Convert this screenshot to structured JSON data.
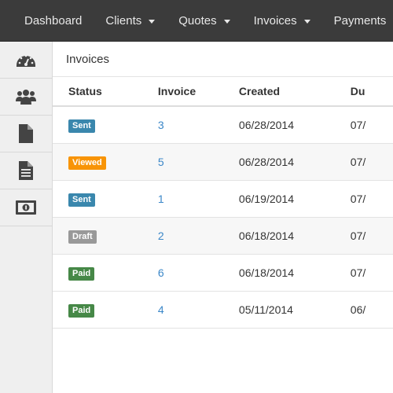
{
  "nav": {
    "items": [
      {
        "label": "Dashboard",
        "dropdown": false
      },
      {
        "label": "Clients",
        "dropdown": true
      },
      {
        "label": "Quotes",
        "dropdown": true
      },
      {
        "label": "Invoices",
        "dropdown": true
      },
      {
        "label": "Payments",
        "dropdown": true
      }
    ]
  },
  "sidebar": {
    "items": [
      "dashboard-gauge-icon",
      "clients-users-icon",
      "quote-file-icon",
      "invoice-document-icon",
      "payment-money-icon"
    ]
  },
  "page": {
    "title": "Invoices"
  },
  "table": {
    "headers": [
      "Status",
      "Invoice",
      "Created",
      "Du"
    ],
    "rows": [
      {
        "status": "Sent",
        "status_color": "#3a87ad",
        "invoice": "3",
        "created": "06/28/2014",
        "due": "07/"
      },
      {
        "status": "Viewed",
        "status_color": "#f89406",
        "invoice": "5",
        "created": "06/28/2014",
        "due": "07/"
      },
      {
        "status": "Sent",
        "status_color": "#3a87ad",
        "invoice": "1",
        "created": "06/19/2014",
        "due": "07/"
      },
      {
        "status": "Draft",
        "status_color": "#999999",
        "invoice": "2",
        "created": "06/18/2014",
        "due": "07/"
      },
      {
        "status": "Paid",
        "status_color": "#468847",
        "invoice": "6",
        "created": "06/18/2014",
        "due": "07/"
      },
      {
        "status": "Paid",
        "status_color": "#468847",
        "invoice": "4",
        "created": "05/11/2014",
        "due": "06/"
      }
    ]
  },
  "colors": {
    "nav_bg": "#3b3b3b",
    "link": "#3b87c8"
  }
}
